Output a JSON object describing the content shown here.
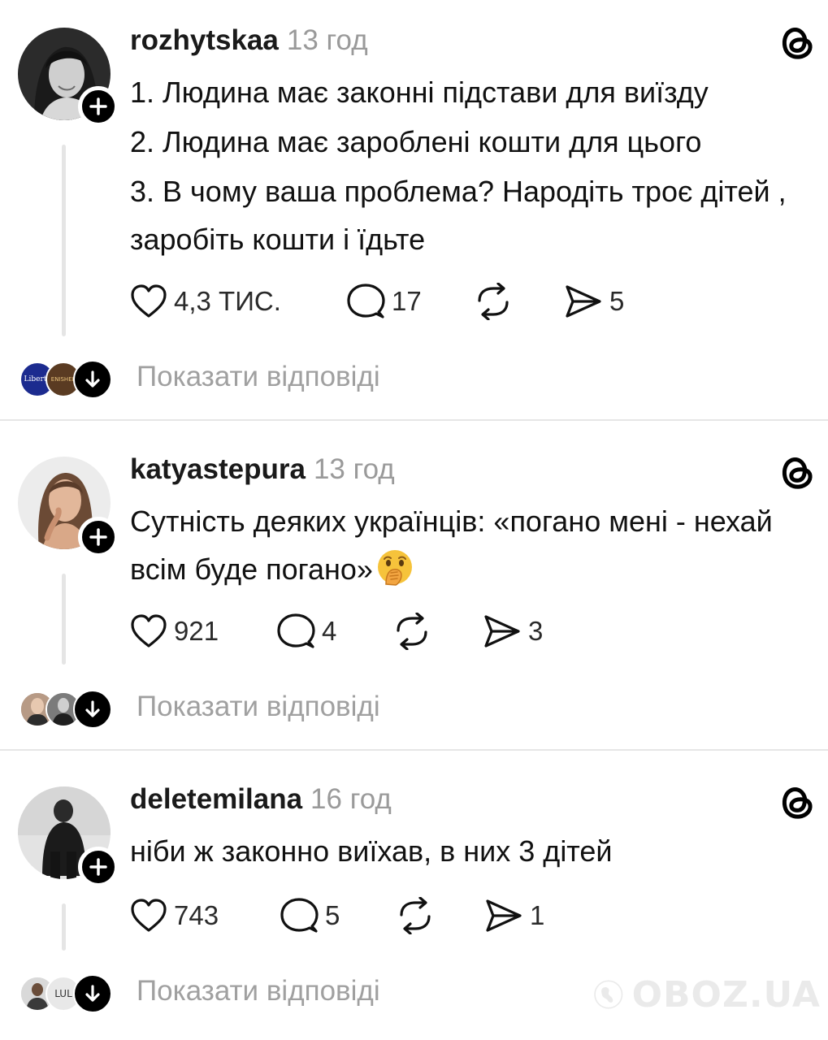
{
  "posts": [
    {
      "username": "rozhytskaa",
      "time": "13 год",
      "lines": [
        "1. Людина має законні підстави для виїзду",
        "2. Людина має зароблені кошти для цього",
        "3. В чому ваша проблема? Народіть троє дітей , заробіть кошти і їдьте"
      ],
      "likes": "4,3 тис.",
      "comments": "17",
      "shares": "5",
      "show_replies": "Показати відповіді",
      "mini_avatar_1_text": "Liberty",
      "mini_avatar_2_text": "ENISHEK"
    },
    {
      "username": "katyastepura",
      "time": "13 год",
      "text": "Сутність деяких українців: «погано мені - нехай всім буде погано»",
      "emoji": "face-with-hand-over-mouth",
      "likes": "921",
      "comments": "4",
      "shares": "3",
      "show_replies": "Показати відповіді"
    },
    {
      "username": "deletemilana",
      "time": "16 год",
      "text": "ніби ж законно виїхав, в них 3 дітей",
      "likes": "743",
      "comments": "5",
      "shares": "1",
      "show_replies": "Показати відповіді",
      "mini_avatar_2_text": "LUL"
    }
  ],
  "watermark": {
    "text": "OBOZ.UA"
  },
  "icons": {
    "like": "heart-icon",
    "comment": "comment-icon",
    "repost": "repost-icon",
    "share": "send-icon",
    "platform": "threads-icon",
    "follow": "plus-icon",
    "expand": "arrow-down-icon"
  }
}
